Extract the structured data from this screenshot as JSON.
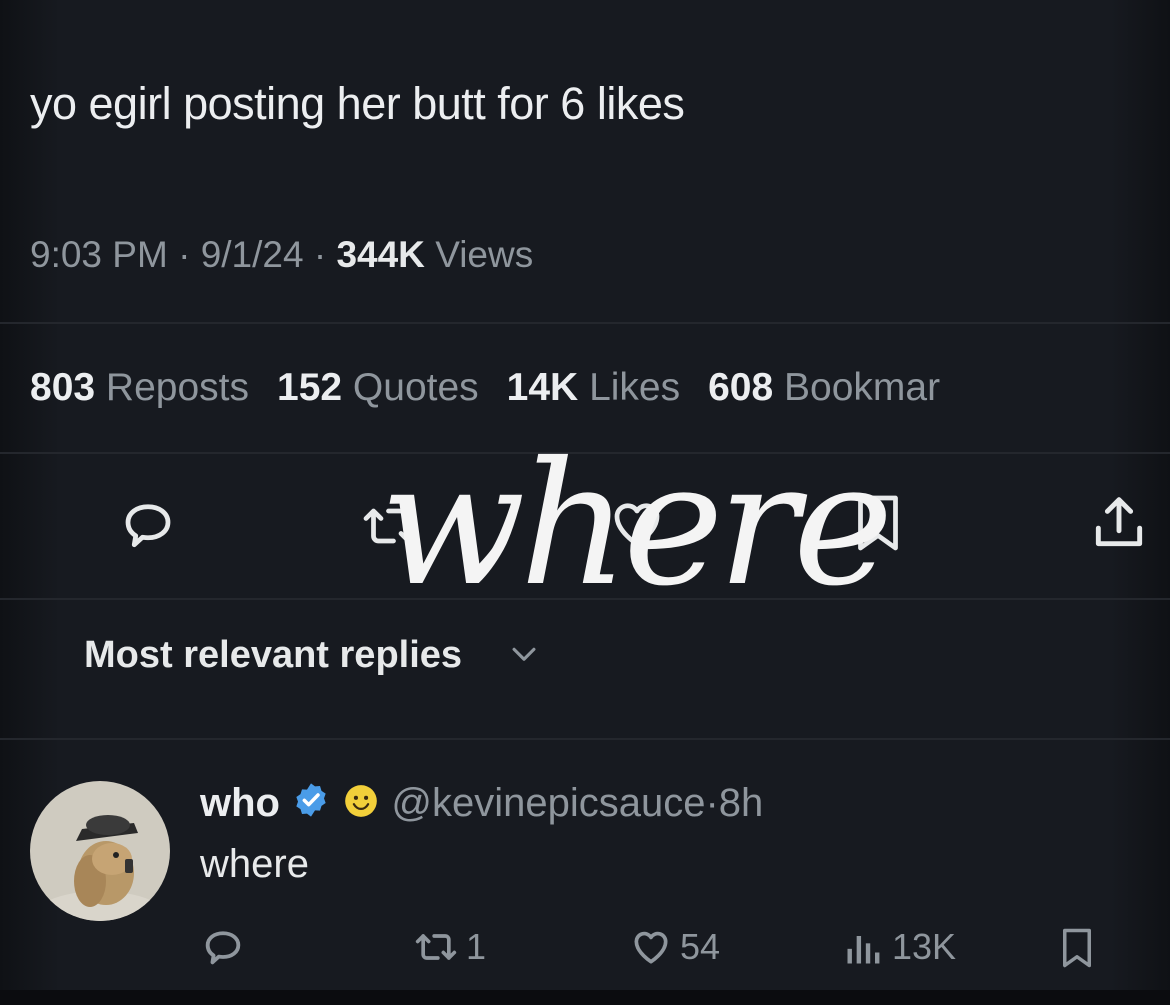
{
  "post": {
    "text": "yo egirl posting her butt for 6 likes",
    "time": "9:03 PM",
    "date": "9/1/24",
    "views_count": "344K",
    "views_label": "Views",
    "separator": "·"
  },
  "stats": [
    {
      "count": "803",
      "label": "Reposts"
    },
    {
      "count": "152",
      "label": "Quotes"
    },
    {
      "count": "14K",
      "label": "Likes"
    },
    {
      "count": "608",
      "label": "Bookmar"
    }
  ],
  "overlay_text": "where",
  "replies_sort": {
    "label": "Most relevant replies"
  },
  "reply": {
    "display_name": "who",
    "handle": "@kevinepicsauce",
    "age": "8h",
    "separator": "·",
    "text": "where",
    "reposts": "1",
    "likes": "54",
    "views": "13K"
  },
  "icons": {
    "reply": "comment-icon",
    "repost": "repost-icon",
    "like": "heart-icon",
    "bookmark": "bookmark-icon",
    "share": "share-icon",
    "verified": "verified-badge-icon",
    "emoji": "smiley-emoji-icon",
    "views": "bar-chart-icon",
    "sort": "chevron-down-icon"
  },
  "colors": {
    "background": "#15171c",
    "text_primary": "#e7e9ea",
    "text_secondary": "#8f969d",
    "verified_blue": "#4a9ce8",
    "emoji_yellow": "#f2cf3a"
  }
}
